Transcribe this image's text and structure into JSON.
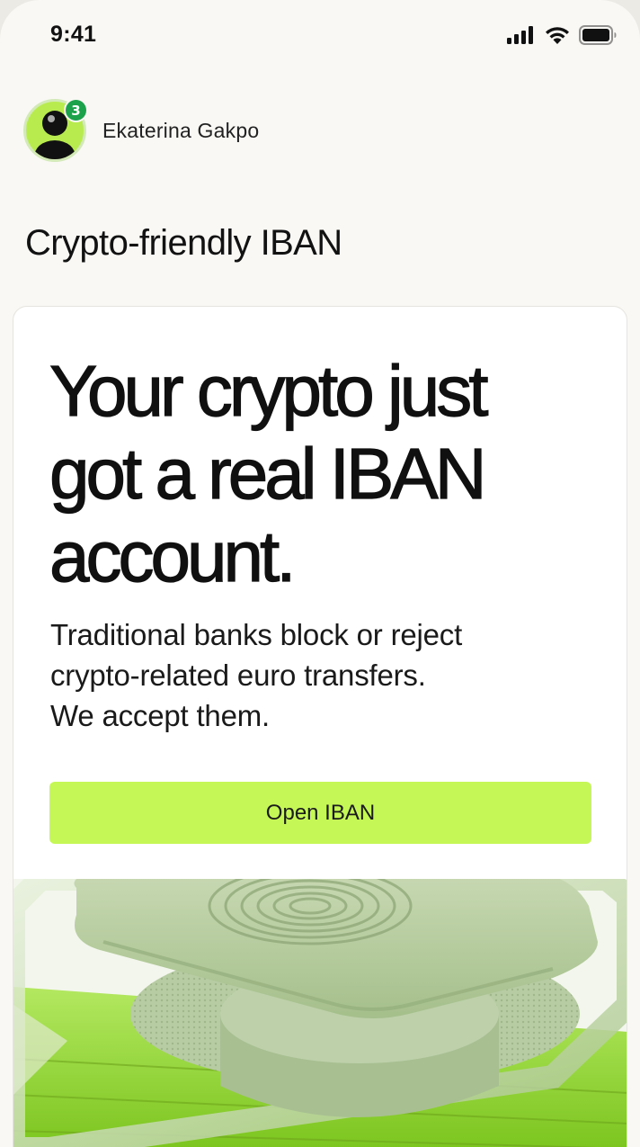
{
  "status_bar": {
    "time": "9:41"
  },
  "user": {
    "name": "Ekaterina Gakpo",
    "notification_count": "3"
  },
  "section": {
    "title": "Crypto-friendly IBAN"
  },
  "promo": {
    "headline_lines": [
      "Your crypto just",
      "got a real IBAN",
      "account."
    ],
    "body_lines": [
      "Traditional banks block or reject",
      "crypto-related euro transfers.",
      "We accept them."
    ],
    "cta_label": "Open IBAN"
  },
  "colors": {
    "background": "#f9f8f4",
    "card": "#ffffff",
    "accent": "#c5f757",
    "badge": "#1ca24a",
    "text": "#101010"
  },
  "icons": {
    "status": [
      "signal-icon",
      "wifi-icon",
      "battery-icon"
    ],
    "badge": "notification-badge",
    "illustration": "fingerprint-chip-illustration"
  }
}
